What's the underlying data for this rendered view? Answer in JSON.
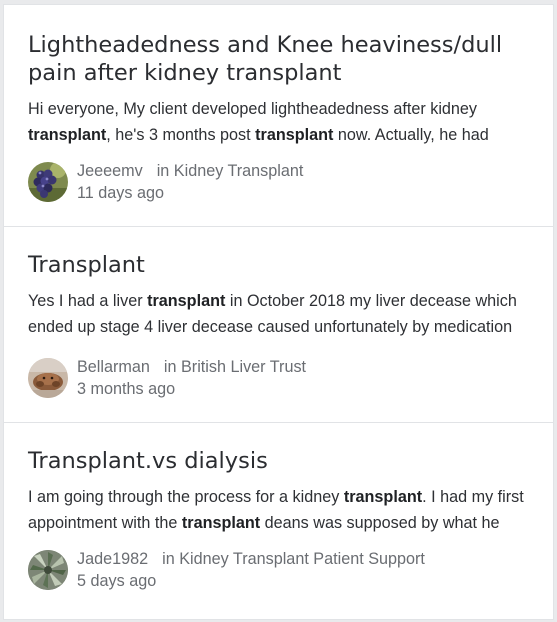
{
  "posts": [
    {
      "title": "Lightheadedness and Knee heaviness/dull pain after kidney transplant",
      "excerpt_lines": [
        [
          {
            "text": "Hi everyone, My client developed lightheadedness after kidney",
            "bold": false
          }
        ],
        [
          {
            "text": "transplant",
            "bold": true
          },
          {
            "text": ", he's 3 months post ",
            "bold": false
          },
          {
            "text": "transplant",
            "bold": true
          },
          {
            "text": " now. Actually, he had",
            "bold": false
          }
        ]
      ],
      "author": "Jeeeemv",
      "community_prefix": "in",
      "community": "Kidney Transplant",
      "time": "11 days ago",
      "avatar_icon": "grapes-avatar-icon"
    },
    {
      "title": "Transplant",
      "excerpt_lines": [
        [
          {
            "text": "Yes I had a liver ",
            "bold": false
          },
          {
            "text": "transplant",
            "bold": true
          },
          {
            "text": " in October 2018 my liver decease which",
            "bold": false
          }
        ],
        [
          {
            "text": "ended up stage 4 liver decease caused unfortunately by medication",
            "bold": false
          }
        ]
      ],
      "author": "Bellarman",
      "community_prefix": "in",
      "community": "British Liver Trust",
      "time": "3 months ago",
      "avatar_icon": "animal-avatar-icon"
    },
    {
      "title": "Transplant.vs dialysis",
      "excerpt_lines": [
        [
          {
            "text": "I am going through the process for a kidney ",
            "bold": false
          },
          {
            "text": "transplant",
            "bold": true
          },
          {
            "text": ". I had my first",
            "bold": false
          }
        ],
        [
          {
            "text": "appointment with the ",
            "bold": false
          },
          {
            "text": "transplant",
            "bold": true
          },
          {
            "text": " deans was supposed by what he",
            "bold": false
          }
        ]
      ],
      "author": "Jade1982",
      "community_prefix": "in",
      "community": "Kidney Transplant Patient Support",
      "time": "5 days ago",
      "avatar_icon": "plant-avatar-icon"
    }
  ],
  "colors": {
    "page_background": "#e9eaec",
    "card_background": "#ffffff",
    "divider": "#e1e3e6",
    "title_text": "#2b2d31",
    "body_text": "#2e3034",
    "meta_text": "#6a6d72"
  }
}
